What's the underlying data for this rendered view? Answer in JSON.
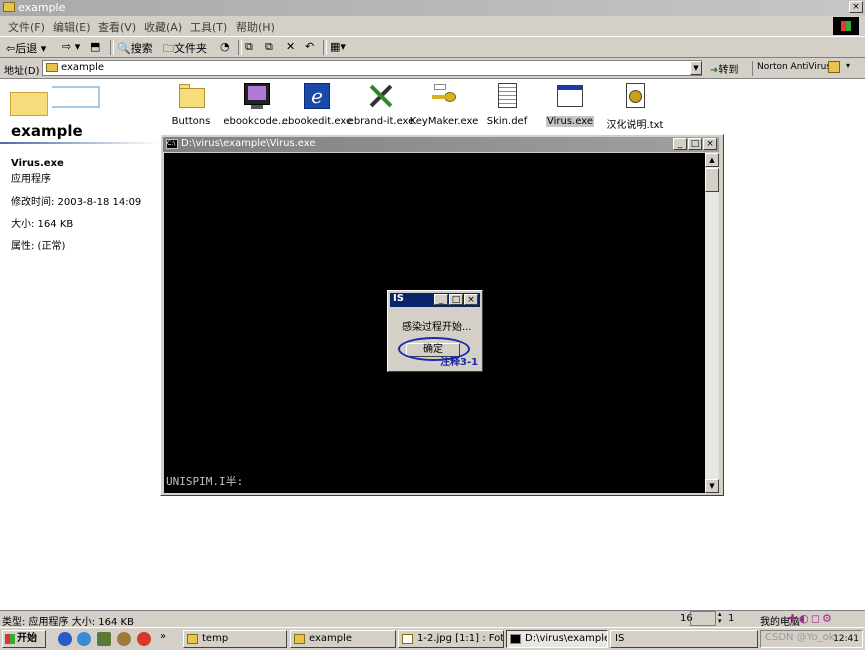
{
  "window": {
    "title": "example",
    "colors": {
      "titlebar": "#a9a9a9",
      "chrome": "#d4d0c8",
      "dialog_title": "#0a246a",
      "annotation": "#1a2aa8"
    }
  },
  "menu": {
    "items": [
      "文件(F)",
      "编辑(E)",
      "查看(V)",
      "收藏(A)",
      "工具(T)",
      "帮助(H)"
    ]
  },
  "toolbar": {
    "back_label": "后退",
    "search_label": "搜索",
    "folders_label": "文件夹"
  },
  "address": {
    "label": "地址(D)",
    "value": "example",
    "go_label": "转到",
    "norton_label": "Norton AntiVirus"
  },
  "left_panel": {
    "folder_title": "example",
    "file_name": "Virus.exe",
    "file_type": "应用程序",
    "modified": "修改时间: 2003-8-18 14:09",
    "size": "大小: 164 KB",
    "attributes": "属性: (正常)"
  },
  "files": [
    {
      "label": "Buttons",
      "icon": "folder-icon"
    },
    {
      "label": "ebookcode....",
      "icon": "monitor-app-icon"
    },
    {
      "label": "ebookedit.exe",
      "icon": "ebook-e-icon"
    },
    {
      "label": "ebrand-it.exe",
      "icon": "tools-icon"
    },
    {
      "label": "KeyMaker.exe",
      "icon": "key-icon"
    },
    {
      "label": "Skin.def",
      "icon": "document-icon"
    },
    {
      "label": "Virus.exe",
      "icon": "window-app-icon"
    },
    {
      "label": "汉化说明.txt",
      "icon": "text-file-icon"
    }
  ],
  "console": {
    "title": "D:\\virus\\example\\Virus.exe",
    "prompt": "UNISPIM.I半:"
  },
  "dialog": {
    "title": "IS",
    "message": "感染过程开始...",
    "ok_label": "确定",
    "annotation": "注释3-1"
  },
  "statusbar": {
    "text": "类型: 应用程序 大小: 164 KB",
    "zoom_left": "16",
    "zoom_right": "1",
    "tray_text": "我的电脑"
  },
  "taskbar": {
    "start_label": "开始",
    "tasks": [
      "temp",
      "example",
      "1-2.jpg [1:1] : Fot...",
      "D:\\virus\\example\\...",
      "IS"
    ],
    "clock": "12:41",
    "watermark": "CSDN @Yo_ok"
  }
}
